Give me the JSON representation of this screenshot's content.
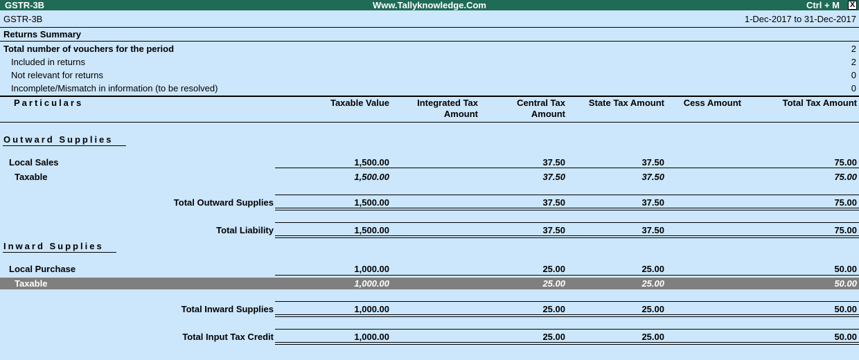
{
  "window": {
    "app_title": "GSTR-3B",
    "site": "Www.Tallyknowledge.Com",
    "shortcut": "Ctrl + M",
    "close": "X"
  },
  "header": {
    "report_name": "GSTR-3B",
    "period": "1-Dec-2017 to 31-Dec-2017"
  },
  "summary": {
    "title": "Returns Summary",
    "total_label": "Total number of vouchers for the period",
    "total_value": "2",
    "rows": [
      {
        "label": "Included in returns",
        "value": "2"
      },
      {
        "label": "Not relevant for returns",
        "value": "0"
      },
      {
        "label": "Incomplete/Mismatch in information (to be resolved)",
        "value": "0"
      }
    ]
  },
  "columns": {
    "particulars": "Particulars",
    "taxable": "Taxable Value",
    "igst_line1": "Integrated Tax",
    "igst_line2": "Amount",
    "cgst_line1": "Central Tax",
    "cgst_line2": "Amount",
    "sgst": "State Tax Amount",
    "cess": "Cess Amount",
    "total": "Total Tax Amount"
  },
  "outward": {
    "title": "Outward Supplies",
    "group": {
      "label": "Local Sales",
      "taxable": "1,500.00",
      "igst": "",
      "cgst": "37.50",
      "sgst": "37.50",
      "cess": "",
      "total": "75.00"
    },
    "sub": {
      "label": "Taxable",
      "taxable": "1,500.00",
      "igst": "",
      "cgst": "37.50",
      "sgst": "37.50",
      "cess": "",
      "total": "75.00"
    },
    "total": {
      "label": "Total Outward Supplies",
      "taxable": "1,500.00",
      "igst": "",
      "cgst": "37.50",
      "sgst": "37.50",
      "cess": "",
      "total": "75.00"
    },
    "liability": {
      "label": "Total Liability",
      "taxable": "1,500.00",
      "igst": "",
      "cgst": "37.50",
      "sgst": "37.50",
      "cess": "",
      "total": "75.00"
    }
  },
  "inward": {
    "title": "Inward Supplies",
    "group": {
      "label": "Local Purchase",
      "taxable": "1,000.00",
      "igst": "",
      "cgst": "25.00",
      "sgst": "25.00",
      "cess": "",
      "total": "50.00"
    },
    "sub": {
      "label": "Taxable",
      "taxable": "1,000.00",
      "igst": "",
      "cgst": "25.00",
      "sgst": "25.00",
      "cess": "",
      "total": "50.00"
    },
    "total": {
      "label": "Total Inward Supplies",
      "taxable": "1,000.00",
      "igst": "",
      "cgst": "25.00",
      "sgst": "25.00",
      "cess": "",
      "total": "50.00"
    },
    "itc": {
      "label": "Total Input Tax Credit",
      "taxable": "1,000.00",
      "igst": "",
      "cgst": "25.00",
      "sgst": "25.00",
      "cess": "",
      "total": "50.00"
    }
  }
}
